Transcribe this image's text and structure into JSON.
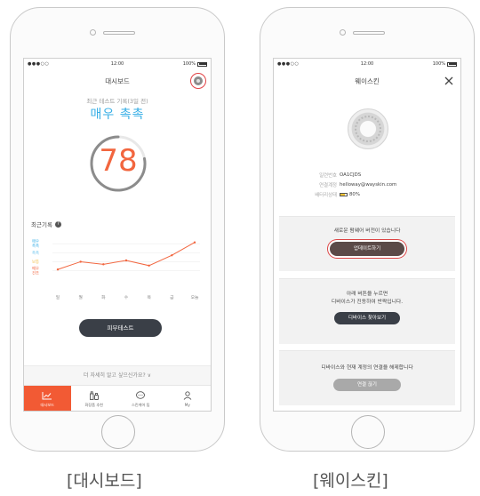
{
  "status_bar": {
    "carrier": "●●●○○ ",
    "time": "12:00",
    "battery": "100%"
  },
  "dashboard": {
    "title": "대시보드",
    "recent_test": "최근 테스트 기록(3일 전)",
    "status_text": "매우 촉촉",
    "score": "78",
    "history_title": "최근기록",
    "help_icon": "?",
    "chart_data": {
      "type": "line",
      "categories": [
        "일",
        "월",
        "화",
        "수",
        "목",
        "금",
        "오늘"
      ],
      "y_labels": [
        "매우 촉촉",
        "촉촉",
        "보통",
        "매우 건조"
      ],
      "values": [
        1.3,
        1.9,
        1.7,
        2.0,
        1.6,
        2.4,
        3.4
      ],
      "ylim": [
        0,
        4
      ],
      "color": "#f2663f"
    },
    "skin_test_button": "피부테스트",
    "more_info": "더 자세히 알고 싶으신가요?",
    "tabs": [
      {
        "label": "대시보드",
        "icon": "chart-icon"
      },
      {
        "label": "화장품 추천",
        "icon": "cosmetics-icon"
      },
      {
        "label": "스킨케어 팁",
        "icon": "chat-icon"
      },
      {
        "label": "My",
        "icon": "person-icon"
      }
    ],
    "accent_color": "#f25a34"
  },
  "wayskin": {
    "title": "웨이스킨",
    "serial_label": "일련번호",
    "serial_value": "OA1CJDS",
    "account_label": "연결계정",
    "account_value": "helloway@wayskin.com",
    "battery_label": "배터리상태",
    "battery_value": "80%",
    "battery_level": 0.8,
    "update_text": "새로운 펌웨어 버전이 있습니다",
    "update_button": "업데이트하기",
    "find_text_1": "아래 버튼을 누르면",
    "find_text_2": "디바이스가 진동하여 반짝입니다.",
    "find_button": "디바이스 찾아보기",
    "disconnect_text": "디바이스와 현재 계정의 연결을 해제합니다",
    "disconnect_button": "연결 끊기"
  },
  "captions": {
    "left": "[대시보드]",
    "right": "[웨이스킨]"
  }
}
